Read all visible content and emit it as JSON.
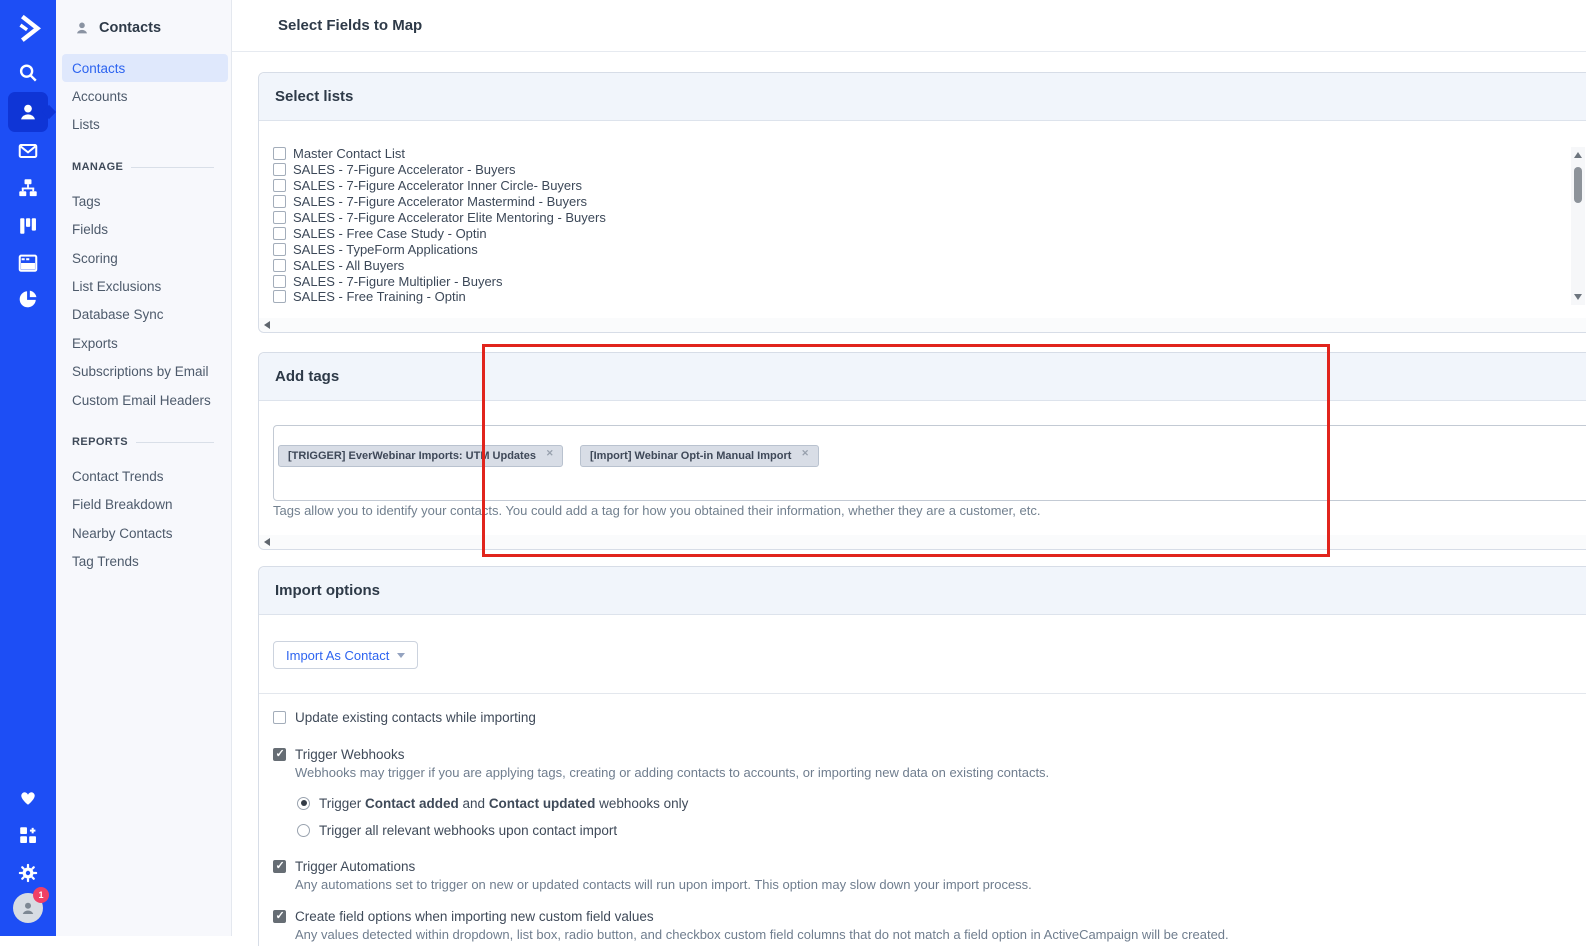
{
  "colors": {
    "rail_blue": "#1d4ef5",
    "rail_active_blue": "#0f35d6",
    "accent_blue": "#2d64f0",
    "annotation_red": "#e1241c",
    "selected_item_bg": "#dfe8fc",
    "badge_red": "#ef4066",
    "tag_bg": "#d8dde6",
    "panel_header_bg": "#f1f5fb"
  },
  "rail": {
    "icons": [
      "activecampaign-logo",
      "search-icon",
      "contacts-icon",
      "campaigns-icon",
      "automations-icon",
      "deals-icon",
      "forms-icon",
      "reports-icon"
    ],
    "bottom_icons": [
      "favorites-icon",
      "apps-icon",
      "settings-icon",
      "account-avatar"
    ],
    "badge_count": "1"
  },
  "sidebar": {
    "title": "Contacts",
    "top_items": [
      {
        "label": "Contacts",
        "selected": true
      },
      {
        "label": "Accounts",
        "selected": false
      },
      {
        "label": "Lists",
        "selected": false
      }
    ],
    "sections": [
      {
        "heading": "MANAGE",
        "items": [
          "Tags",
          "Fields",
          "Scoring",
          "List Exclusions",
          "Database Sync",
          "Exports",
          "Subscriptions by Email",
          "Custom Email Headers"
        ]
      },
      {
        "heading": "REPORTS",
        "items": [
          "Contact Trends",
          "Field Breakdown",
          "Nearby Contacts",
          "Tag Trends"
        ]
      }
    ]
  },
  "main": {
    "page_title": "Select Fields to Map",
    "select_lists": {
      "title": "Select lists",
      "items": [
        {
          "label": "Master Contact List",
          "checked": false
        },
        {
          "label": "SALES - 7-Figure Accelerator - Buyers",
          "checked": false
        },
        {
          "label": "SALES - 7-Figure Accelerator Inner Circle- Buyers",
          "checked": false
        },
        {
          "label": "SALES - 7-Figure Accelerator Mastermind - Buyers",
          "checked": false
        },
        {
          "label": "SALES - 7-Figure Accelerator Elite Mentoring - Buyers",
          "checked": false
        },
        {
          "label": "SALES - Free Case Study - Optin",
          "checked": false
        },
        {
          "label": "SALES - TypeForm Applications",
          "checked": false
        },
        {
          "label": "SALES - All Buyers",
          "checked": false
        },
        {
          "label": "SALES - 7-Figure Multiplier - Buyers",
          "checked": false
        },
        {
          "label": "SALES - Free Training - Optin",
          "checked": false
        }
      ]
    },
    "add_tags": {
      "title": "Add tags",
      "tags": [
        "[TRIGGER] EverWebinar Imports: UTM Updates",
        "[Import] Webinar Opt-in Manual Import"
      ],
      "help": "Tags allow you to identify your contacts. You could add a tag for how you obtained their information, whether they are a customer, etc."
    },
    "import_options": {
      "title": "Import options",
      "import_as_label": "Import As Contact",
      "options": [
        {
          "label": "Update existing contacts while importing",
          "checked": false,
          "description": ""
        },
        {
          "label": "Trigger Webhooks",
          "checked": true,
          "description": "Webhooks may trigger if you are applying tags, creating or adding contacts to accounts, or importing new data on existing contacts."
        },
        {
          "label": "Trigger Automations",
          "checked": true,
          "description": "Any automations set to trigger on new or updated contacts will run upon import. This option may slow down your import process."
        },
        {
          "label": "Create field options when importing new custom field values",
          "checked": true,
          "description": "Any values detected within dropdown, list box, radio button, and checkbox custom field columns that do not match a field option in ActiveCampaign will be created."
        }
      ],
      "webhook_radios": [
        {
          "pre": "Trigger ",
          "b1": "Contact added",
          "mid": " and ",
          "b2": "Contact updated",
          "post": " webhooks only",
          "selected": true
        },
        {
          "label": "Trigger all relevant webhooks upon contact import",
          "selected": false
        }
      ]
    }
  }
}
